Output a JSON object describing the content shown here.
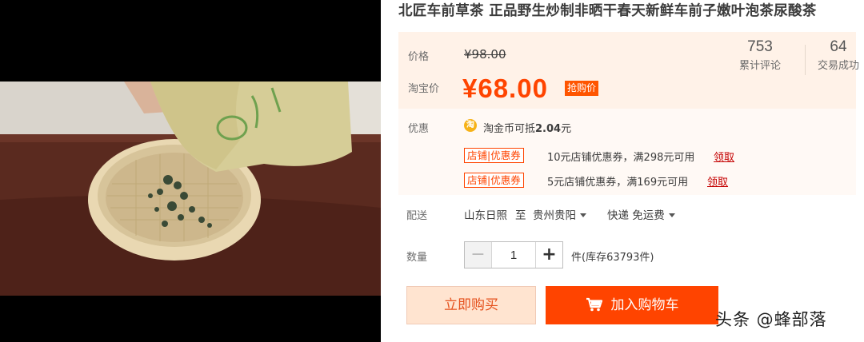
{
  "product": {
    "title": "北匠车前草茶 正品野生炒制非晒干春天新鲜车前子嫩叶泡茶尿酸茶"
  },
  "price": {
    "label": "价格",
    "original": "¥98.00",
    "taobao_label": "淘宝价",
    "current": "¥68.00",
    "badge": "抢购价"
  },
  "stats": {
    "reviews_value": "753",
    "reviews_label": "累计评论",
    "sales_value": "64",
    "sales_label": "交易成功"
  },
  "promo": {
    "label": "优惠",
    "coin_icon": "淘",
    "coin_text_prefix": "淘金币可抵",
    "coin_amount": "2.04",
    "coin_text_suffix": "元",
    "coupons": [
      {
        "tag_left": "店铺",
        "tag_sep": "|",
        "tag_right": "优惠券",
        "desc": "10元店铺优惠券，满298元可用",
        "link": "领取"
      },
      {
        "tag_left": "店铺",
        "tag_sep": "|",
        "tag_right": "优惠券",
        "desc": "5元店铺优惠券，满169元可用",
        "link": "领取"
      }
    ]
  },
  "shipping": {
    "label": "配送",
    "from": "山东日照",
    "to_word": "至",
    "to": "贵州贵阳",
    "method": "快递 免运费"
  },
  "quantity": {
    "label": "数量",
    "minus": "−",
    "value": "1",
    "plus": "+",
    "stock": "件(库存63793件)"
  },
  "actions": {
    "buy_now": "立即购买",
    "add_to_cart": "加入购物车"
  },
  "watermark": "头条 @蜂部落",
  "colors": {
    "accent": "#ff4400",
    "price_bg": "#fff2e8",
    "buy_bg": "#ffe4d0"
  },
  "icons": {
    "coin": "taobao-coin-icon",
    "cart": "shopping-cart-icon",
    "dropdown": "caret-down-icon"
  }
}
